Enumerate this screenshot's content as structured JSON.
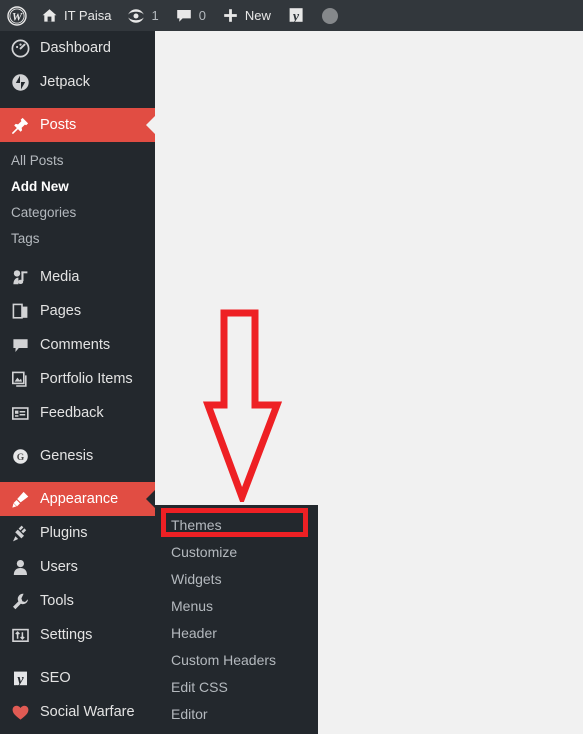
{
  "adminbar": {
    "wp_logo": "wordpress-logo",
    "site_home_icon": "home-icon",
    "site_name": "IT Paisa",
    "updates_icon": "updates-icon",
    "updates_count": "1",
    "comments_icon": "comment-bubble-icon",
    "comments_count": "0",
    "new_icon": "plus-icon",
    "new_label": "New",
    "seo_icon": "yoast-seo-icon",
    "avatar": "user-avatar"
  },
  "sidebar": {
    "items": [
      {
        "label": "Dashboard",
        "icon": "dashboard-icon",
        "current": false
      },
      {
        "label": "Jetpack",
        "icon": "jetpack-icon",
        "current": false
      },
      {
        "label": "Posts",
        "icon": "pin-icon",
        "current": true
      },
      {
        "label": "Media",
        "icon": "media-icon",
        "current": false
      },
      {
        "label": "Pages",
        "icon": "pages-icon",
        "current": false
      },
      {
        "label": "Comments",
        "icon": "comment-bubble-icon",
        "current": false
      },
      {
        "label": "Portfolio Items",
        "icon": "portfolio-icon",
        "current": false
      },
      {
        "label": "Feedback",
        "icon": "feedback-icon",
        "current": false
      },
      {
        "label": "Genesis",
        "icon": "genesis-icon",
        "current": false
      },
      {
        "label": "Appearance",
        "icon": "appearance-brush-icon",
        "current": true
      },
      {
        "label": "Plugins",
        "icon": "plugins-plug-icon",
        "current": false
      },
      {
        "label": "Users",
        "icon": "users-icon",
        "current": false
      },
      {
        "label": "Tools",
        "icon": "tools-wrench-icon",
        "current": false
      },
      {
        "label": "Settings",
        "icon": "settings-sliders-icon",
        "current": false
      },
      {
        "label": "SEO",
        "icon": "yoast-seo-icon",
        "current": false
      },
      {
        "label": "Social Warfare",
        "icon": "social-warfare-icon",
        "current": false
      }
    ],
    "posts_submenu": [
      {
        "label": "All Posts",
        "current": false
      },
      {
        "label": "Add New",
        "current": true
      },
      {
        "label": "Categories",
        "current": false
      },
      {
        "label": "Tags",
        "current": false
      }
    ],
    "appearance_submenu": [
      {
        "label": "Themes",
        "highlighted": true
      },
      {
        "label": "Customize",
        "highlighted": false
      },
      {
        "label": "Widgets",
        "highlighted": false
      },
      {
        "label": "Menus",
        "highlighted": false
      },
      {
        "label": "Header",
        "highlighted": false
      },
      {
        "label": "Custom Headers",
        "highlighted": false
      },
      {
        "label": "Edit CSS",
        "highlighted": false
      },
      {
        "label": "Editor",
        "highlighted": false
      }
    ]
  },
  "annotation": {
    "arrow": "down-arrow-annotation",
    "highlight": "themes-highlight-box",
    "color": "#ee2024"
  },
  "colors": {
    "admin_bar": "#32373c",
    "sidebar": "#23282d",
    "current_menu": "#e14d43",
    "content_bg": "#f1f1f1",
    "annotation_red": "#ee2024"
  }
}
